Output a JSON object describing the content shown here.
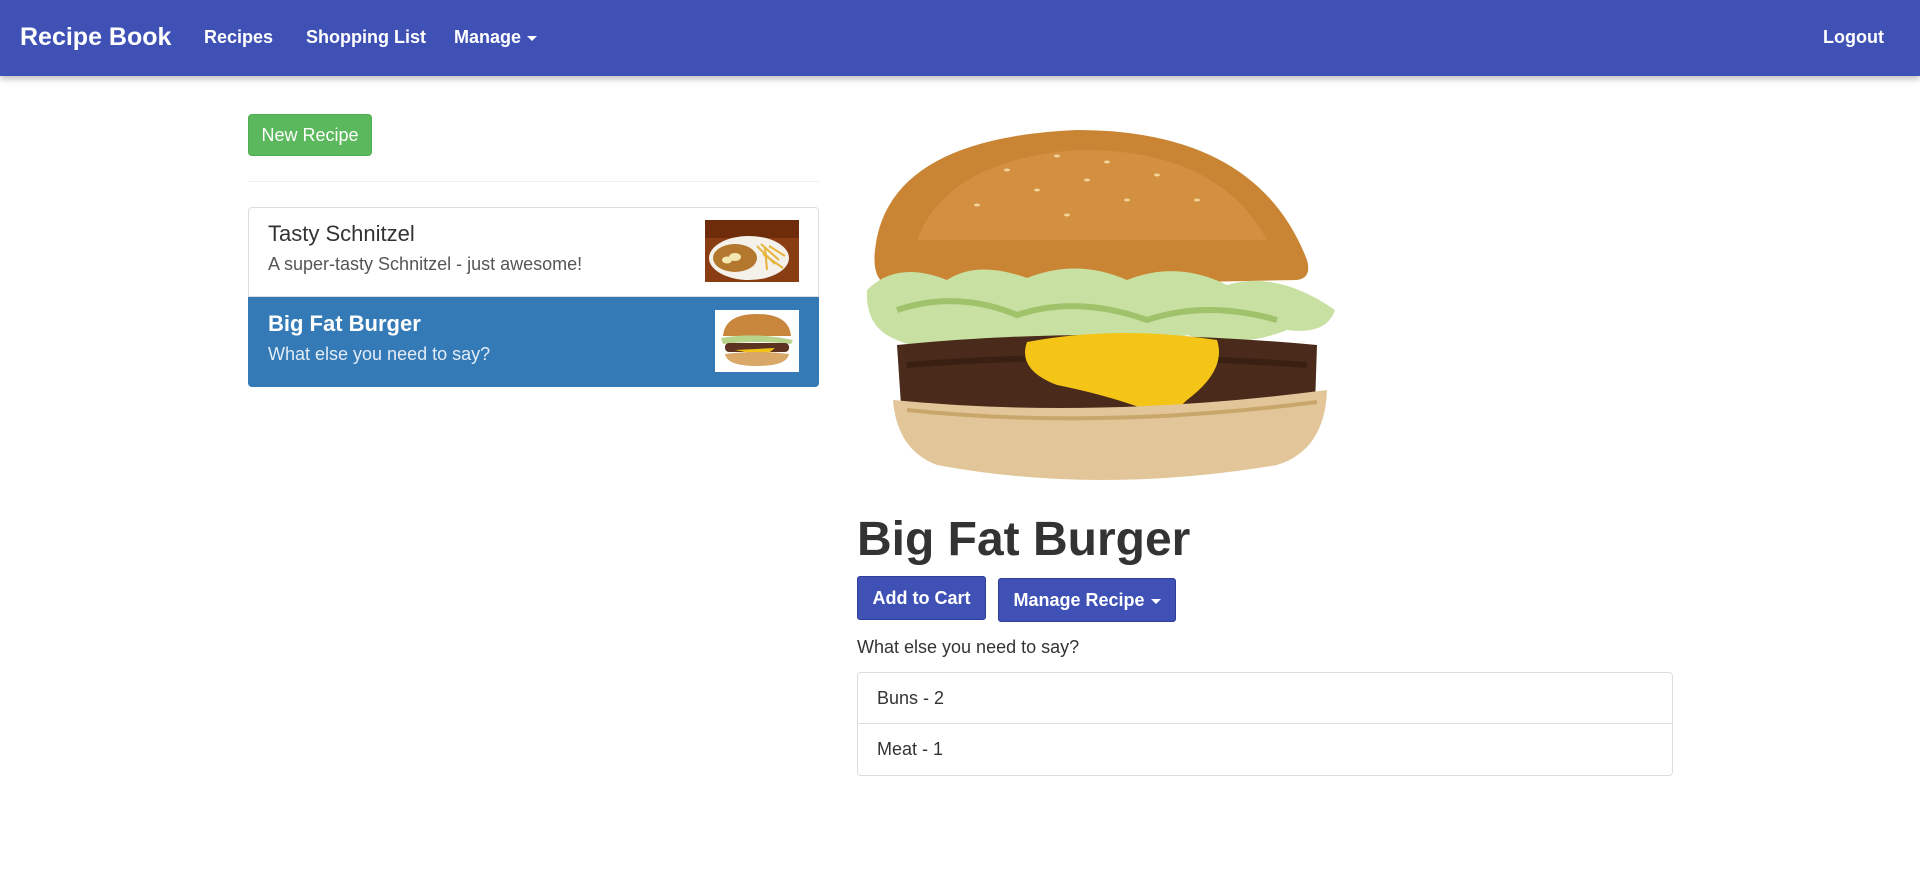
{
  "navbar": {
    "brand": "Recipe Book",
    "links": {
      "recipes": "Recipes",
      "shopping_list": "Shopping List",
      "manage": "Manage",
      "logout": "Logout"
    },
    "background": "#3f51b5"
  },
  "sidebar": {
    "new_recipe_label": "New Recipe",
    "recipes": [
      {
        "name": "Tasty Schnitzel",
        "description": "A super-tasty Schnitzel - just awesome!",
        "image": "schnitzel-thumbnail",
        "active": false
      },
      {
        "name": "Big Fat Burger",
        "description": "What else you need to say?",
        "image": "burger-thumbnail",
        "active": true
      }
    ],
    "active_color": "#337ab7",
    "new_button_color": "#5cb85c"
  },
  "detail": {
    "image": "burger-image",
    "title": "Big Fat Burger",
    "add_to_cart_label": "Add to Cart",
    "manage_recipe_label": "Manage Recipe",
    "description": "What else you need to say?",
    "ingredients": [
      "Buns - 2",
      "Meat - 1"
    ]
  }
}
